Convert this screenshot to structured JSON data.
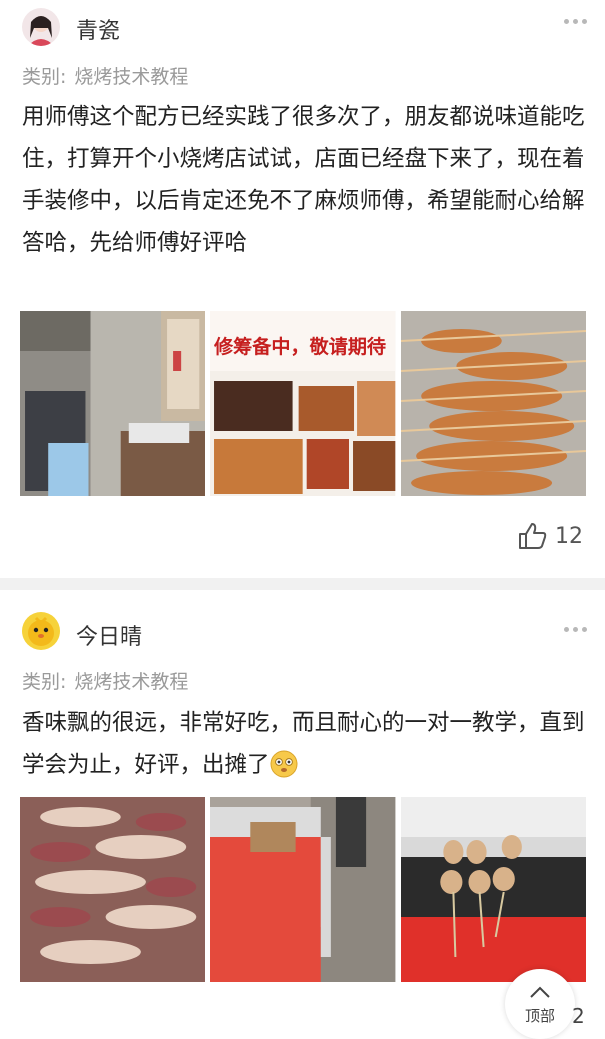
{
  "posts": [
    {
      "username": "青瓷",
      "category_label": "类别:",
      "category_value": "烧烤技术教程",
      "content": "用师傅这个配方已经实践了很多次了，朋友都说味道能吃住，打算开个小烧烤店试试，店面已经盘下来了，现在着手装修中，以后肯定还免不了麻烦师傅，希望能耐心给解答哈，先给师傅好评哈",
      "photos": [
        "kitchen-photo",
        "menu-poster-photo",
        "grilled-skewers-photo"
      ],
      "poster_text": "修筹备中，敬请期待",
      "like_count": "12"
    },
    {
      "username": "今日晴",
      "category_label": "类别:",
      "category_value": "烧烤技术教程",
      "content": "香味飘的很远，非常好吃，而且耐心的一对一教学，直到学会为止，好评，出摊了",
      "photos": [
        "raw-skewers-photo",
        "stall-cart-photo",
        "grill-chicken-photo"
      ]
    }
  ],
  "back_to_top_label": "顶部",
  "edge_digit": "2",
  "colors": {
    "divider": "#f1f1f1",
    "meta": "#9a9a9a"
  }
}
